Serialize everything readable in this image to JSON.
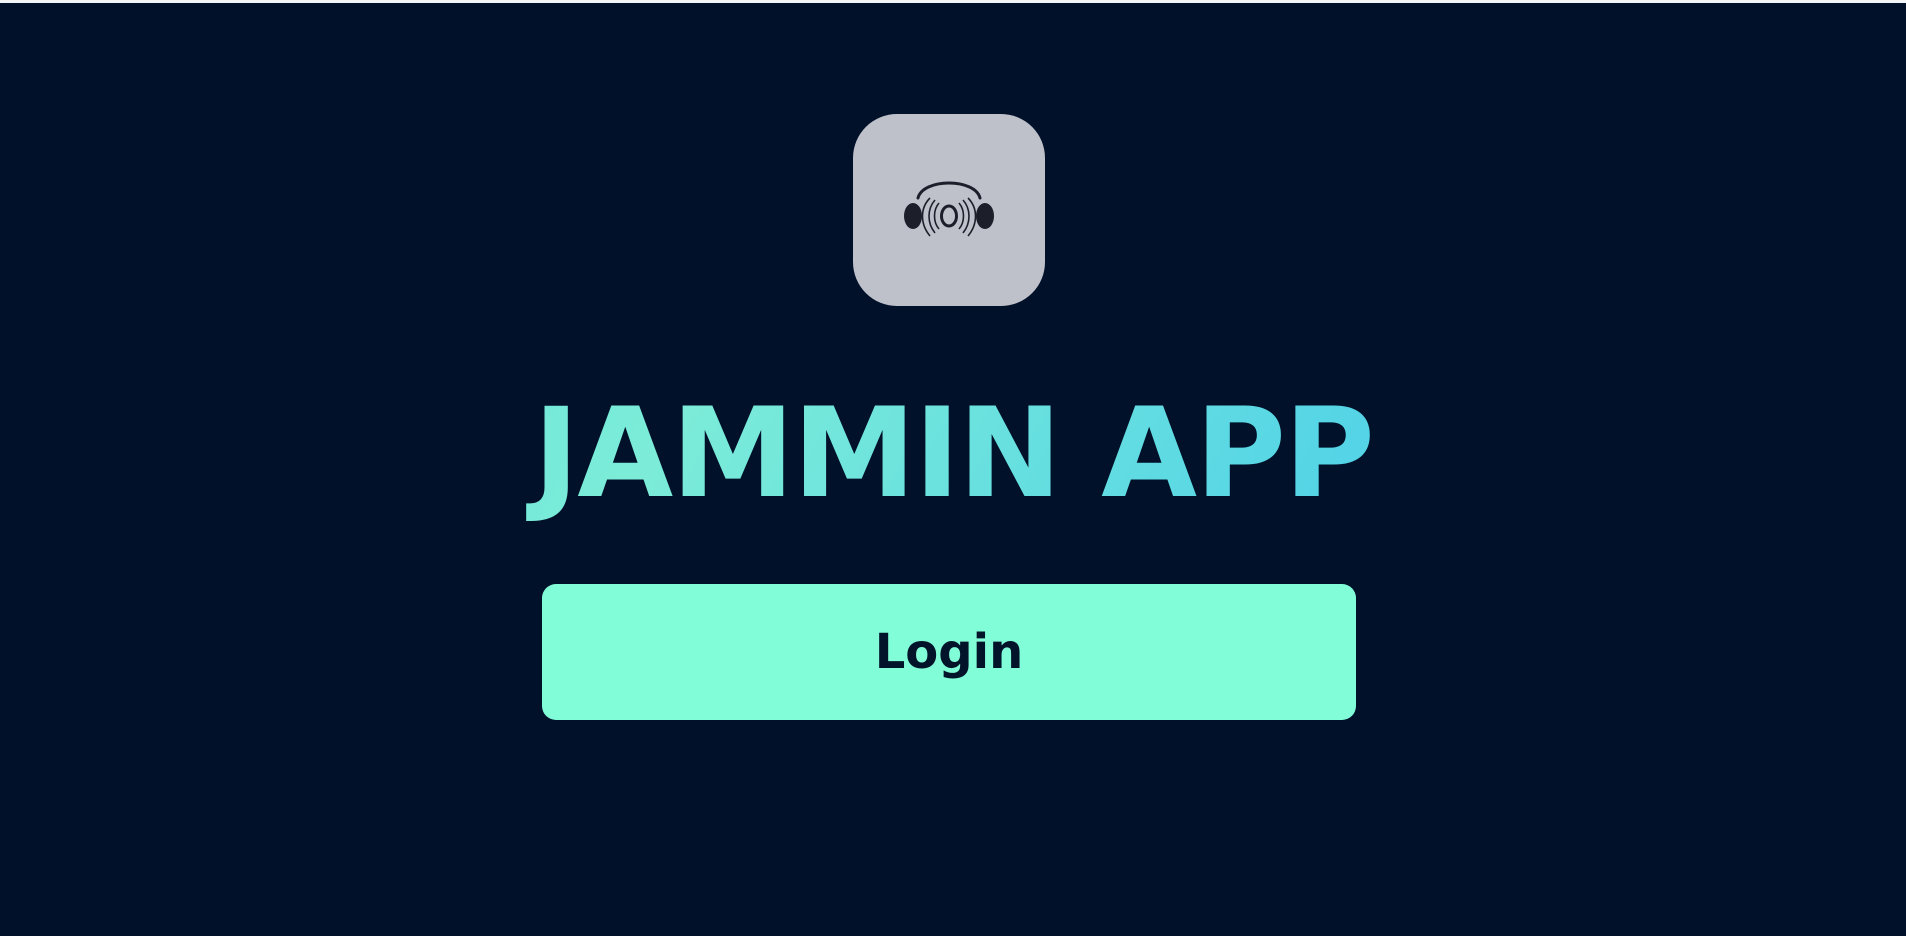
{
  "app": {
    "title": "JAMMIN APP",
    "logo_icon": "headphones-music-icon"
  },
  "actions": {
    "login_label": "Login"
  },
  "colors": {
    "background": "#011129",
    "logo_tile": "#bec1ca",
    "title_accent": "#72e7da",
    "button_background": "#81fdd8",
    "button_text": "#021429"
  }
}
